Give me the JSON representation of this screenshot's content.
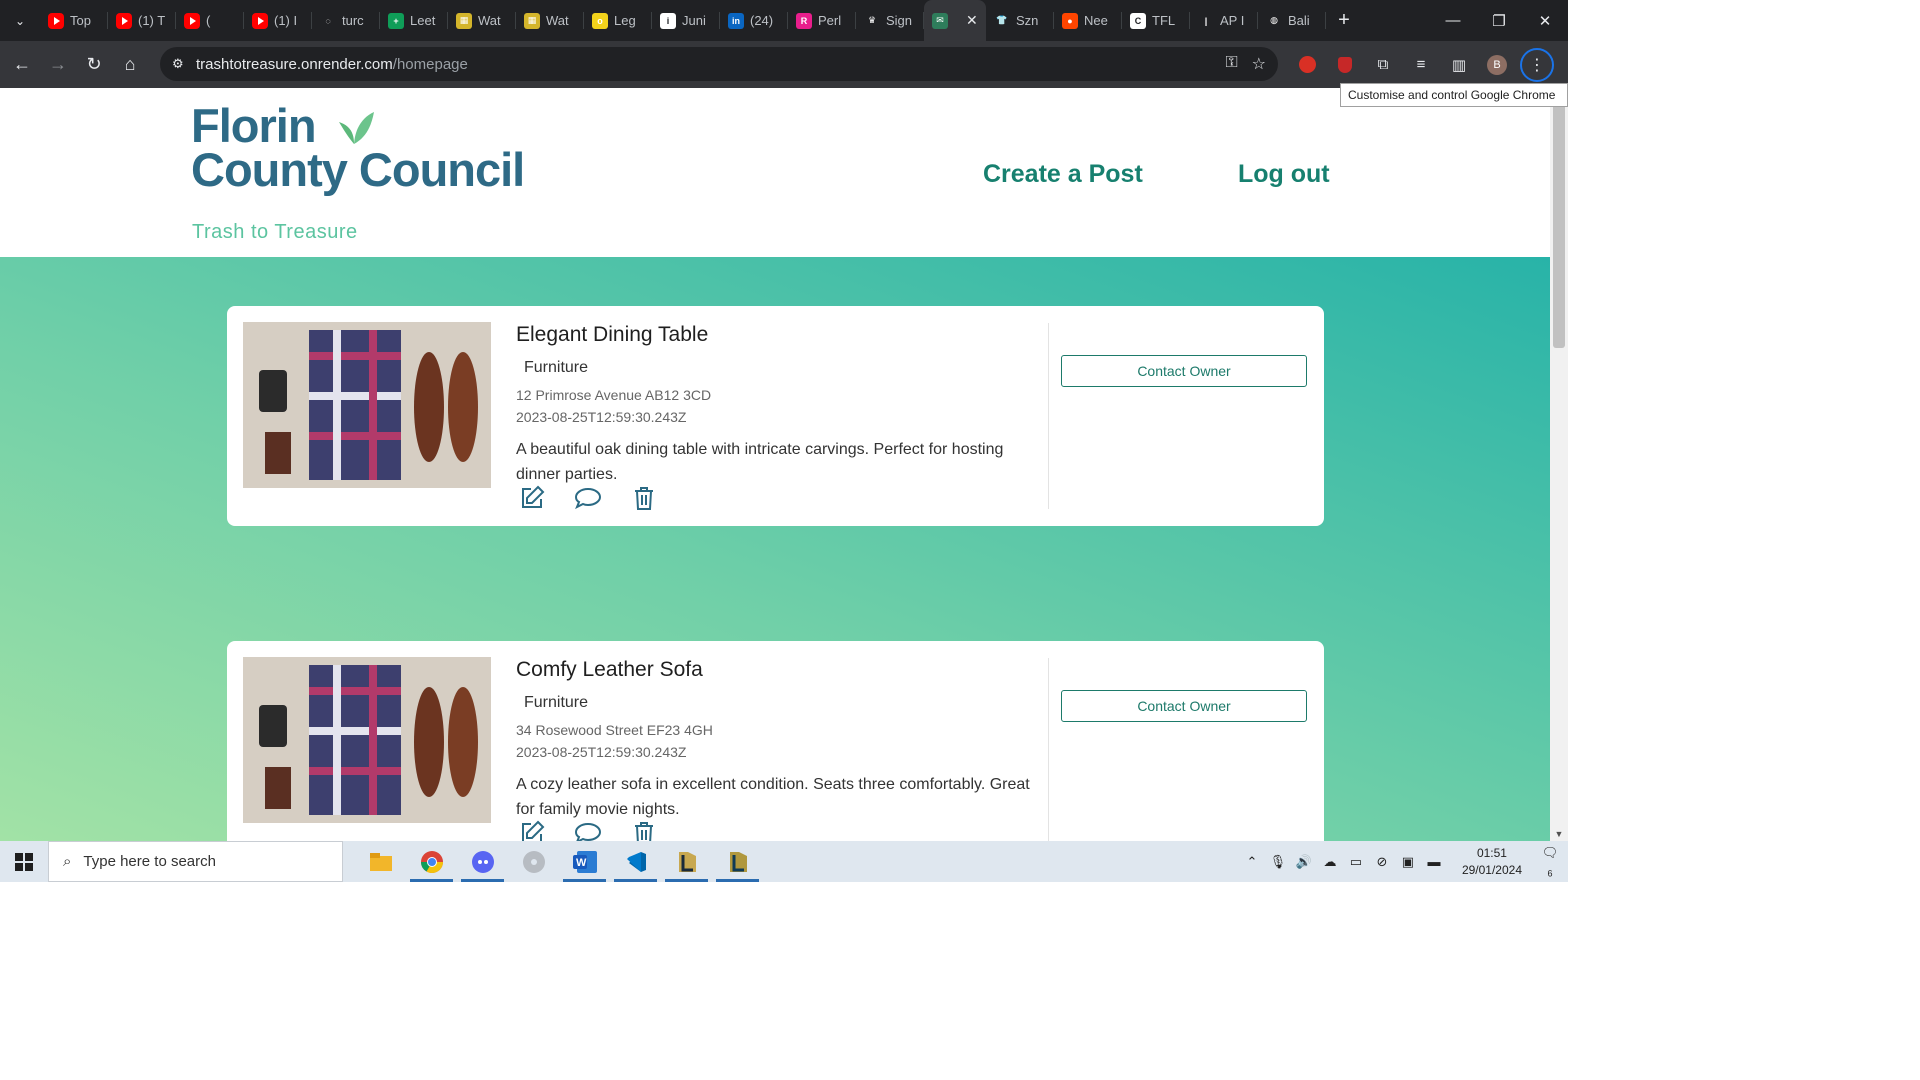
{
  "browser": {
    "tabs": [
      {
        "label": "Top",
        "favicon": "youtube"
      },
      {
        "label": "(1) T",
        "favicon": "youtube"
      },
      {
        "label": "(",
        "favicon": "youtube-audio"
      },
      {
        "label": "(1) I",
        "favicon": "youtube"
      },
      {
        "label": "turc",
        "favicon": "loading"
      },
      {
        "label": "Leet",
        "favicon": "plus"
      },
      {
        "label": "Wat",
        "favicon": "grid"
      },
      {
        "label": "Wat",
        "favicon": "grid"
      },
      {
        "label": "Leg",
        "favicon": "otta"
      },
      {
        "label": "Juni",
        "favicon": "info"
      },
      {
        "label": "(24)",
        "favicon": "linkedin"
      },
      {
        "label": "Perl",
        "favicon": "r"
      },
      {
        "label": "Sign",
        "favicon": "crown"
      },
      {
        "label": "",
        "favicon": "trash-to-treasure",
        "active": true
      },
      {
        "label": "Szn",
        "favicon": "shirt"
      },
      {
        "label": "Nee",
        "favicon": "reddit"
      },
      {
        "label": "TFL",
        "favicon": "c"
      },
      {
        "label": "AP I",
        "favicon": "bar"
      },
      {
        "label": "Bali",
        "favicon": "globe"
      }
    ],
    "url_domain": "trashtotreasure.onrender.com",
    "url_path": "/homepage",
    "tooltip": "Customise and control Google Chrome",
    "profile_initial": "B"
  },
  "site": {
    "logo_line1": "Florin",
    "logo_line2": "County Council",
    "tagline": "Trash to Treasure",
    "nav_create": "Create a Post",
    "nav_logout": "Log out",
    "contact_label": "Contact Owner",
    "accent": "#17806f",
    "logo_color": "#2e6a86"
  },
  "posts": [
    {
      "title": "Elegant Dining Table",
      "category": "Furniture",
      "address": "12 Primrose Avenue AB12 3CD",
      "date": "2023-08-25T12:59:30.243Z",
      "description": "A beautiful oak dining table with intricate carvings. Perfect for hosting dinner parties."
    },
    {
      "title": "Comfy Leather Sofa",
      "category": "Furniture",
      "address": "34 Rosewood Street EF23 4GH",
      "date": "2023-08-25T12:59:30.243Z",
      "description": "A cozy leather sofa in excellent condition. Seats three comfortably. Great for family movie nights."
    }
  ],
  "taskbar": {
    "search_placeholder": "Type here to search",
    "time": "01:51",
    "date": "29/01/2024",
    "notification_count": "6"
  }
}
